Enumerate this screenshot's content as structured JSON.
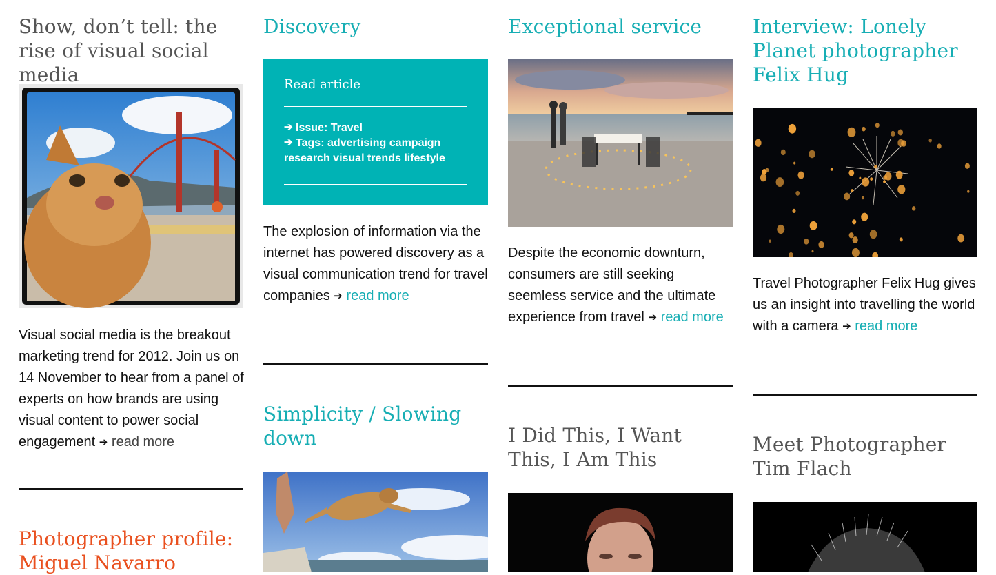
{
  "articles": {
    "visual_social": {
      "title": "Show, don’t tell: the rise of visual social media",
      "body": "Visual social media is the breakout marketing trend for 2012. Join us on 14 November to hear from a panel of experts on how brands are using visual content to power social engagement",
      "more": "read more"
    },
    "photographer_profile": {
      "title": "Photographer profile: Miguel Navarro"
    },
    "discovery": {
      "title": "Discovery",
      "card_link": "Read article",
      "issue": "Issue: Travel",
      "tags": "Tags: advertising campaign research visual trends lifestyle",
      "body": "The explosion of information via the internet has powered discovery as a visual communication trend for travel companies",
      "more": "read more"
    },
    "simplicity": {
      "title": "Simplicity / Slowing down"
    },
    "exceptional": {
      "title": "Exceptional service",
      "body": "Despite the economic downturn, consumers are still seeking seemless service and the ultimate experience from travel",
      "more": "read more"
    },
    "i_did_this": {
      "title": "I Did This, I Want This, I Am This"
    },
    "interview": {
      "title": "Interview: Lonely Planet photographer Felix Hug",
      "body": "Travel Photographer Felix Hug gives us an insight into travelling the world with a camera",
      "more": "read more"
    },
    "tim_flach": {
      "title": "Meet Photographer Tim Flach"
    }
  },
  "icons": {
    "arrow": "➔"
  },
  "colors": {
    "teal": "#17aeb4",
    "card": "#00b3b5",
    "orange": "#e9501f",
    "grey_title": "#555555"
  }
}
